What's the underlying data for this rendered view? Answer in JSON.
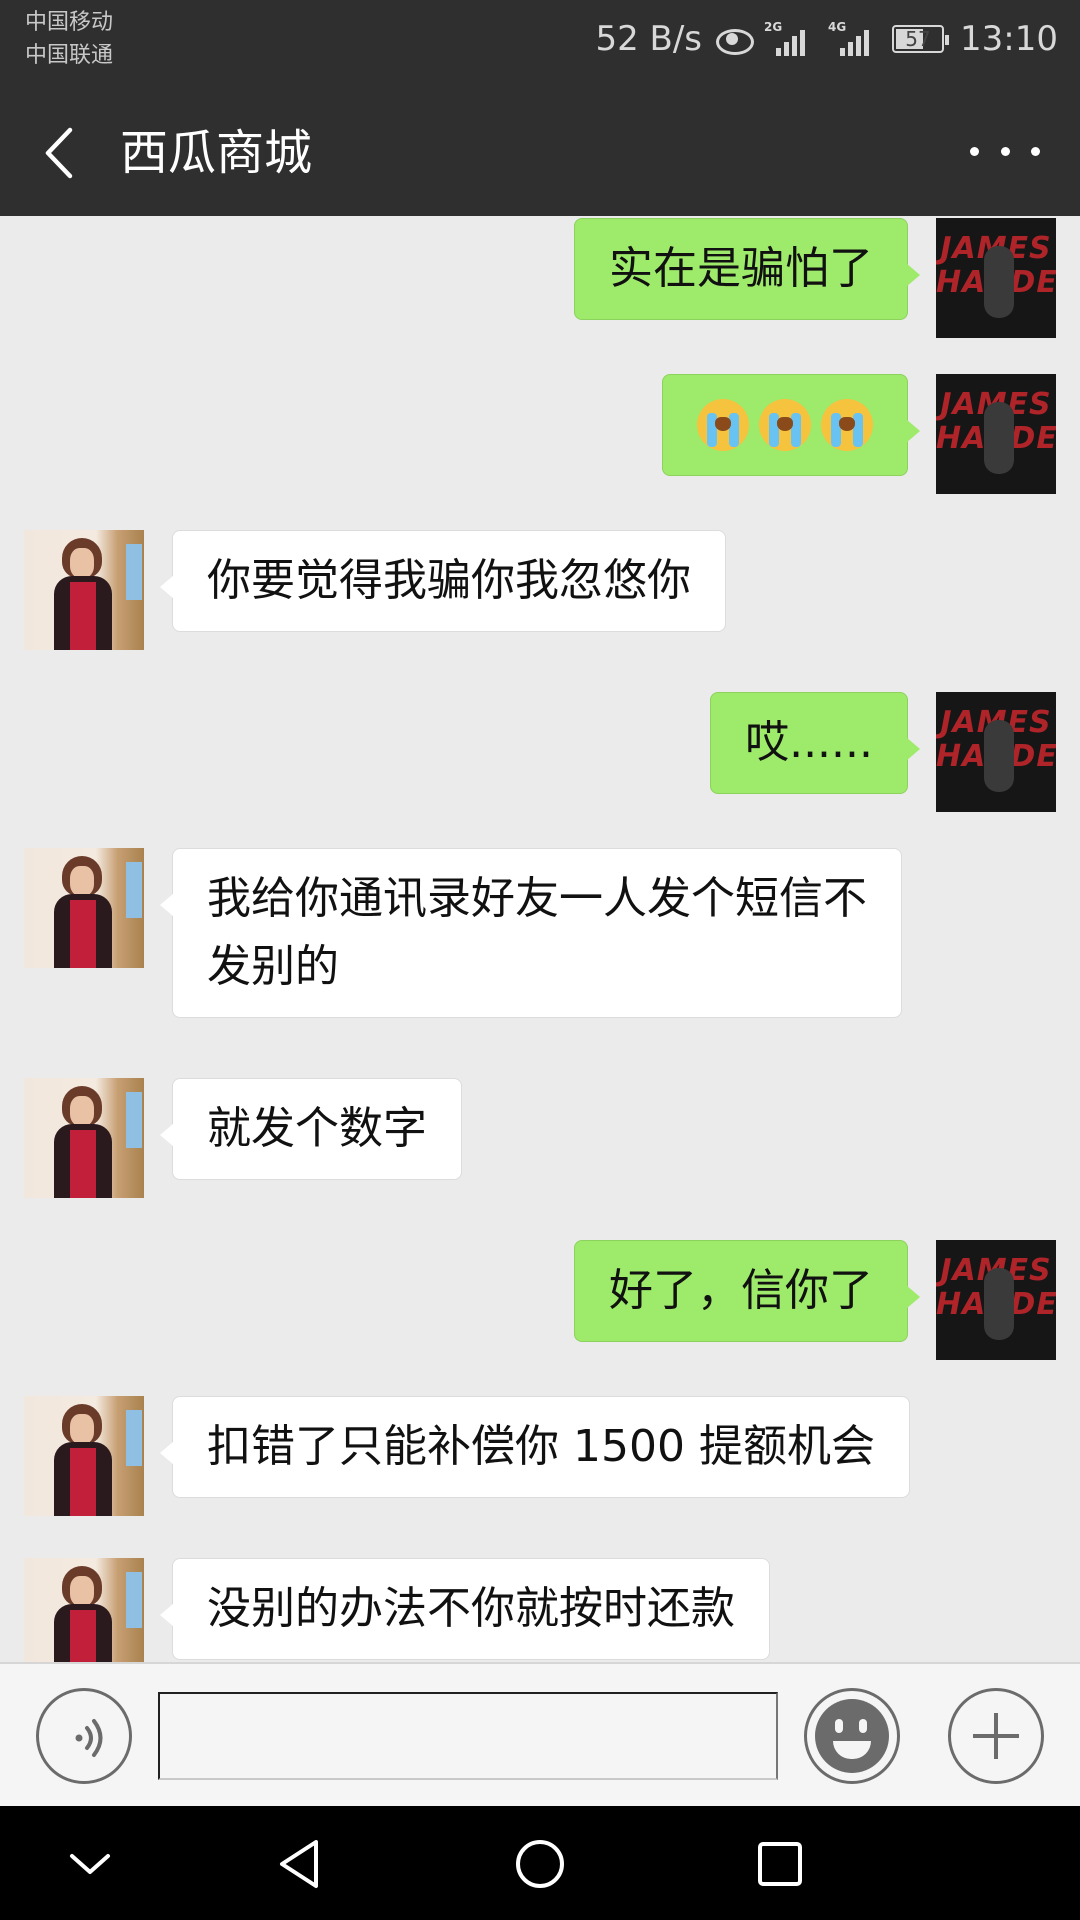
{
  "status_bar": {
    "carrier_1": "中国移动",
    "carrier_2": "中国联通",
    "net_speed": "52 B/s",
    "signal_1": "2G",
    "signal_2": "4G",
    "battery": "57",
    "time": "13:10",
    "icons": [
      "eye-icon",
      "signal-icon",
      "battery-icon"
    ]
  },
  "title_bar": {
    "title": "西瓜商城",
    "icons": [
      "back-arrow-icon",
      "more-dots-icon"
    ]
  },
  "messages": [
    {
      "side": "out",
      "text": "实在是骗怕了"
    },
    {
      "side": "out",
      "emoji": "loudly-crying-face",
      "count": 3
    },
    {
      "side": "in",
      "text": "你要觉得我骗你我忽悠你"
    },
    {
      "side": "out",
      "text": "哎......"
    },
    {
      "side": "in",
      "line_1": "我给你通讯录好友一人发个短信不",
      "line_2": "发别的"
    },
    {
      "side": "in",
      "text": "就发个数字"
    },
    {
      "side": "out",
      "text": "好了，信你了"
    },
    {
      "side": "in",
      "text": "扣错了只能补偿你 1500 提额机会"
    },
    {
      "side": "in",
      "text": "没别的办法不你就按时还款"
    }
  ],
  "input_bar": {
    "input_value": "",
    "icons": [
      "voice-icon",
      "emoji-icon",
      "plus-icon"
    ]
  },
  "nav_bar": {
    "icons": [
      "chevron-down-icon",
      "back-triangle-icon",
      "home-circle-icon",
      "recent-square-icon"
    ]
  },
  "colors": {
    "header_bg": "#2f2f2f",
    "chat_bg": "#ebebeb",
    "outgoing_bubble": "#9eea6a",
    "incoming_bubble": "#ffffff",
    "nav_bg": "#000000"
  }
}
